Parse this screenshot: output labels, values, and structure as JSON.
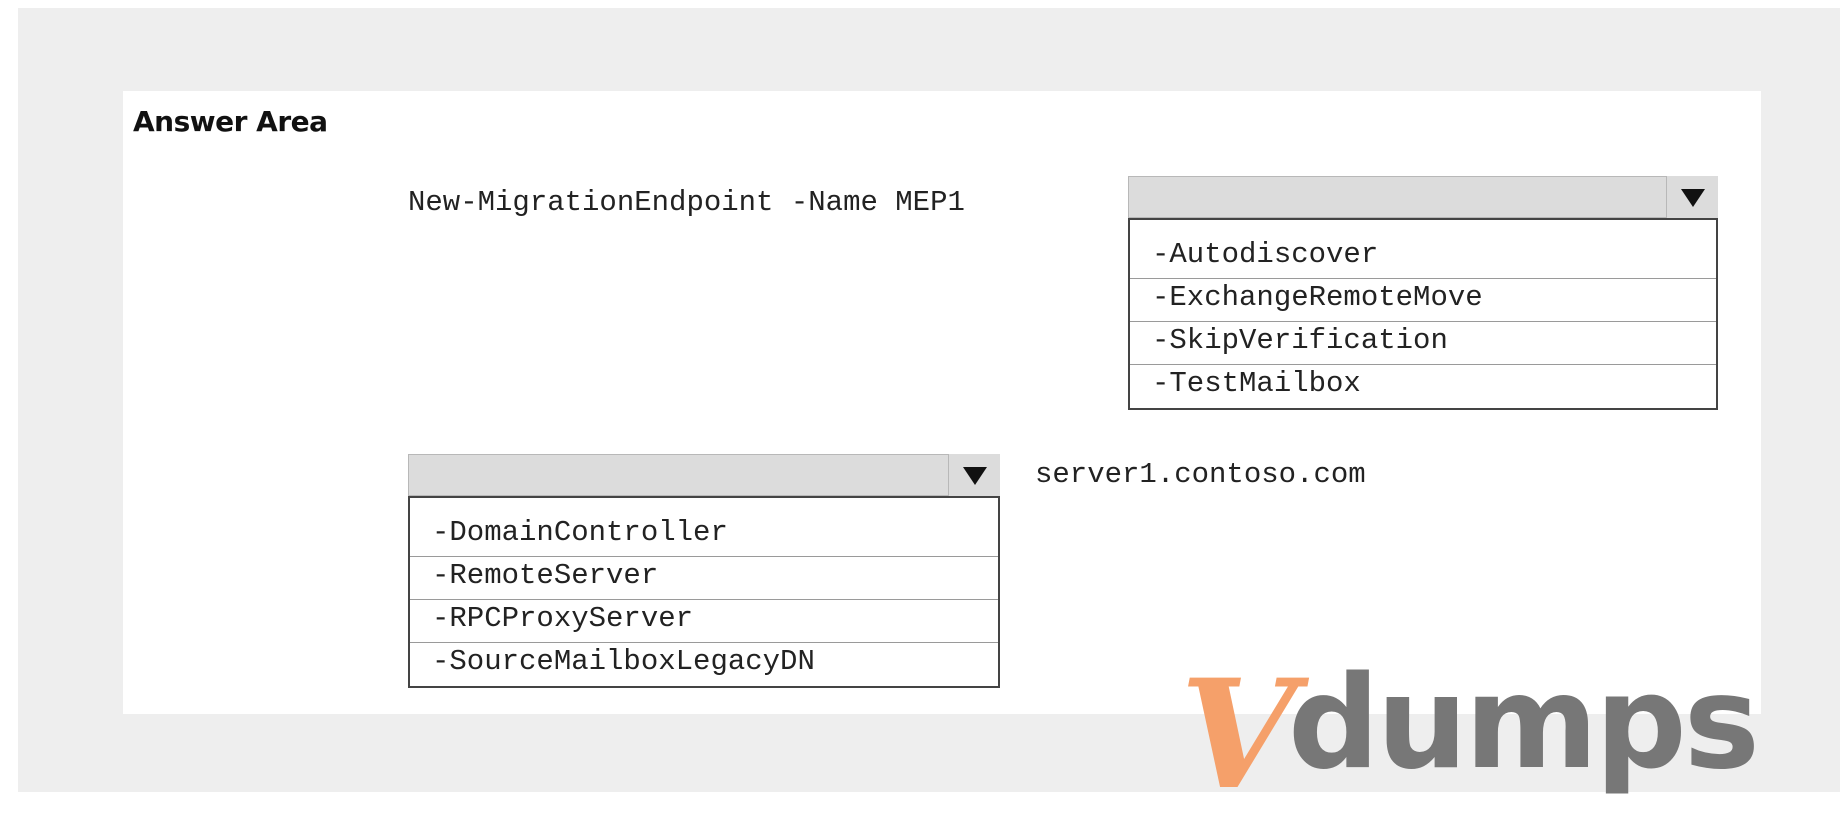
{
  "answer_area": {
    "title": "Answer Area"
  },
  "command": {
    "prefix": "New-MigrationEndpoint -Name MEP1",
    "server": "server1.contoso.com"
  },
  "dropdown_1": {
    "selected": "",
    "options": [
      "-Autodiscover",
      "-ExchangeRemoteMove",
      "-SkipVerification",
      "-TestMailbox"
    ]
  },
  "dropdown_2": {
    "selected": "",
    "options": [
      "-DomainController",
      "-RemoteServer",
      "-RPCProxyServer",
      "-SourceMailboxLegacyDN"
    ]
  },
  "watermark": {
    "logo_letter": "V",
    "logo_text": "dumps",
    "logo_color": "#f5a06a",
    "text_color": "#777777"
  }
}
